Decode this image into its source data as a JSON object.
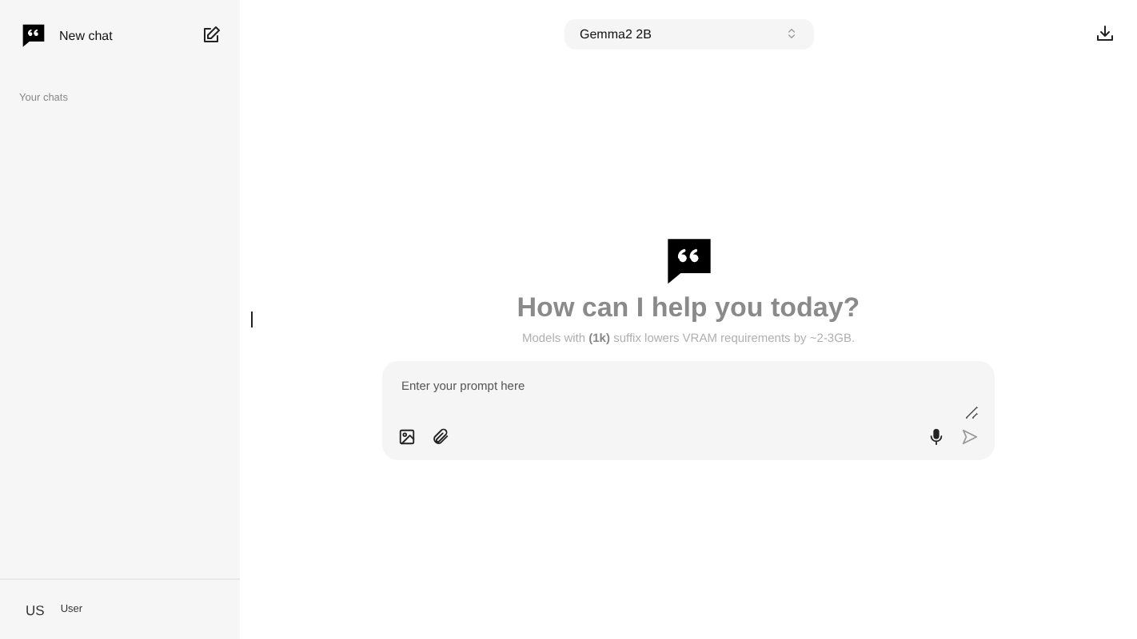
{
  "sidebar": {
    "new_chat": "New chat",
    "section_label": "Your chats",
    "user": {
      "initials": "US",
      "name": "User"
    }
  },
  "model_selector": {
    "value": "Gemma2 2B"
  },
  "welcome": {
    "title": "How can I help you today?",
    "subtitle": "Models with **(1k)** suffix lowers VRAM requirements by ~2-3GB."
  },
  "prompt": {
    "placeholder": "Enter your prompt here"
  }
}
